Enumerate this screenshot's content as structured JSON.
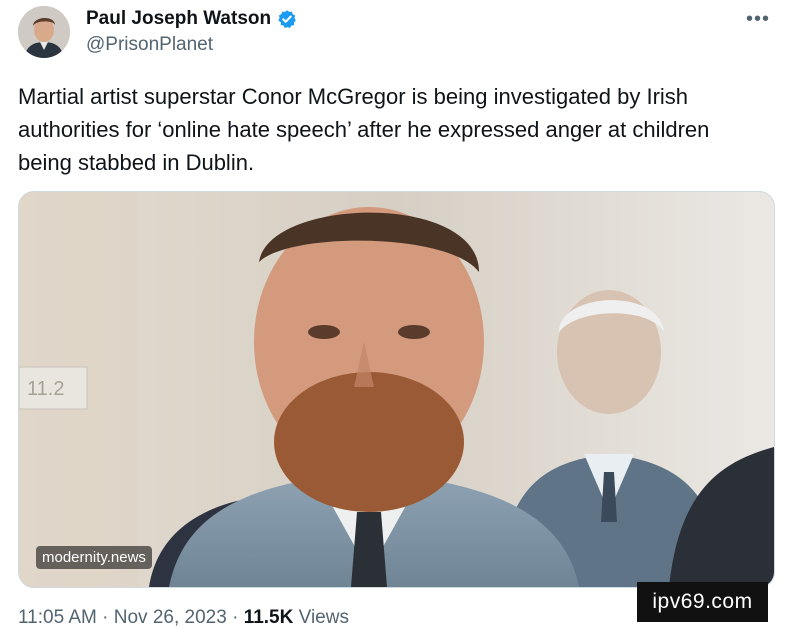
{
  "author": {
    "display_name": "Paul Joseph Watson",
    "handle": "@PrisonPlanet",
    "verified": true,
    "verified_color": "#1d9bf0"
  },
  "menu_icon": "more-horizontal-icon",
  "tweet": {
    "text": "Martial artist superstar Conor McGregor is being investigated by Irish authorities for ‘online hate speech’ after he expressed anger at children being stabbed in Dublin."
  },
  "media": {
    "source_tag": "modernity.news",
    "wall_sign": "11.2"
  },
  "footer": {
    "time": "11:05 AM",
    "sep1": "·",
    "date": "Nov 26, 2023",
    "sep2": "·",
    "views_count": "11.5K",
    "views_label": "Views"
  },
  "watermark": "ipv69.com"
}
